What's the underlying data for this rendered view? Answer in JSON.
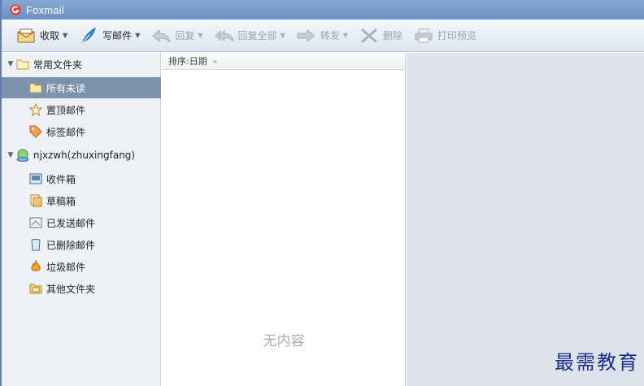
{
  "window": {
    "title": "Foxmail"
  },
  "toolbar": {
    "receive": "收取",
    "compose": "写邮件",
    "reply": "回复",
    "reply_all": "回复全部",
    "forward": "转发",
    "delete": "删除",
    "print_preview": "打印预览"
  },
  "sidebar": {
    "favorites_label": "常用文件夹",
    "favorites": [
      {
        "label": "所有未读"
      },
      {
        "label": "置顶邮件"
      },
      {
        "label": "标签邮件"
      }
    ],
    "account_label": "njxzwh(zhuxingfang)",
    "folders": [
      {
        "label": "收件箱"
      },
      {
        "label": "草稿箱"
      },
      {
        "label": "已发送邮件"
      },
      {
        "label": "已删除邮件"
      },
      {
        "label": "垃圾邮件"
      },
      {
        "label": "其他文件夹"
      }
    ]
  },
  "list": {
    "sort_label": "排序:日期",
    "empty_text": "无内容"
  },
  "watermark": "最需教育",
  "colors": {
    "titlebar": "#6b90c2",
    "selected_row": "#7d93ad",
    "preview_bg": "#dde3ea",
    "watermark": "#1a2f8c"
  }
}
